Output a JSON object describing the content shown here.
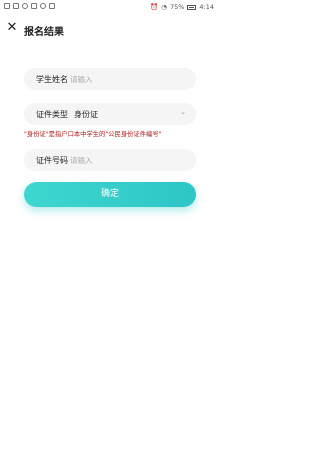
{
  "statusbar": {
    "battery": "75%",
    "time": "4:14"
  },
  "nav": {
    "title": "报名结果"
  },
  "form": {
    "name_label": "学生姓名",
    "name_placeholder": "请输入",
    "idtype_label": "证件类型",
    "idtype_value": "身份证",
    "hint": "\"身份证\"是指户口本中学生的\"公民身份证件编号\"",
    "idnum_label": "证件号码",
    "idnum_placeholder": "请输入",
    "confirm_label": "确定"
  },
  "colors": {
    "accent": "#2ec6c6",
    "hint": "#b01818"
  }
}
